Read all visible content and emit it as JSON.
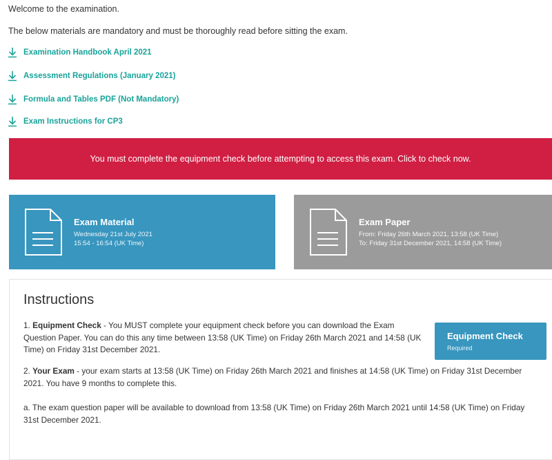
{
  "intro": {
    "welcome": "Welcome to the examination.",
    "mandatory": "The below materials are mandatory and must be thoroughly read before sitting the exam."
  },
  "materials": [
    {
      "label": "Examination Handbook April 2021",
      "icon": "download-icon"
    },
    {
      "label": "Assessment Regulations (January 2021)",
      "icon": "download-icon"
    },
    {
      "label": "Formula and Tables PDF (Not Mandatory)",
      "icon": "download-icon"
    },
    {
      "label": "Exam Instructions for CP3",
      "icon": "download-icon"
    }
  ],
  "alert": {
    "text": "You must complete the equipment check before attempting to access this exam. Click to check now.",
    "color": "#d01f43"
  },
  "tiles": {
    "material": {
      "title": "Exam Material",
      "line1": "Wednesday 21st July 2021",
      "line2": "15:54 - 16:54 (UK Time)",
      "color": "#3896bf"
    },
    "paper": {
      "title": "Exam Paper",
      "line1": "From: Friday 26th March 2021, 13:58 (UK Time)",
      "line2": "To: Friday 31st December 2021, 14:58 (UK Time)",
      "color": "#9b9b9b"
    }
  },
  "instructions": {
    "heading": "Instructions",
    "item1_num": "1. ",
    "item1_bold": "Equipment Check",
    "item1_text": " - You MUST complete your equipment check before you can download the Exam Question Paper. You can do this any time between 13:58 (UK Time) on Friday 26th March 2021 and 14:58 (UK Time) on Friday 31st December 2021.",
    "item2_num": "2. ",
    "item2_bold": "Your Exam",
    "item2_text": " - your exam starts at 13:58 (UK Time) on Friday 26th March 2021 and finishes at 14:58 (UK Time) on Friday 31st December 2021. You have 9 months to complete this.",
    "item3_text": "a. The exam question paper will be available to download from 13:58 (UK Time) on Friday 26th March 2021 until 14:58 (UK Time) on Friday 31st December 2021.",
    "button_label": "Equipment Check",
    "button_sub": "Required"
  },
  "colors": {
    "link": "#18a39a",
    "accent_blue": "#3896bf"
  }
}
